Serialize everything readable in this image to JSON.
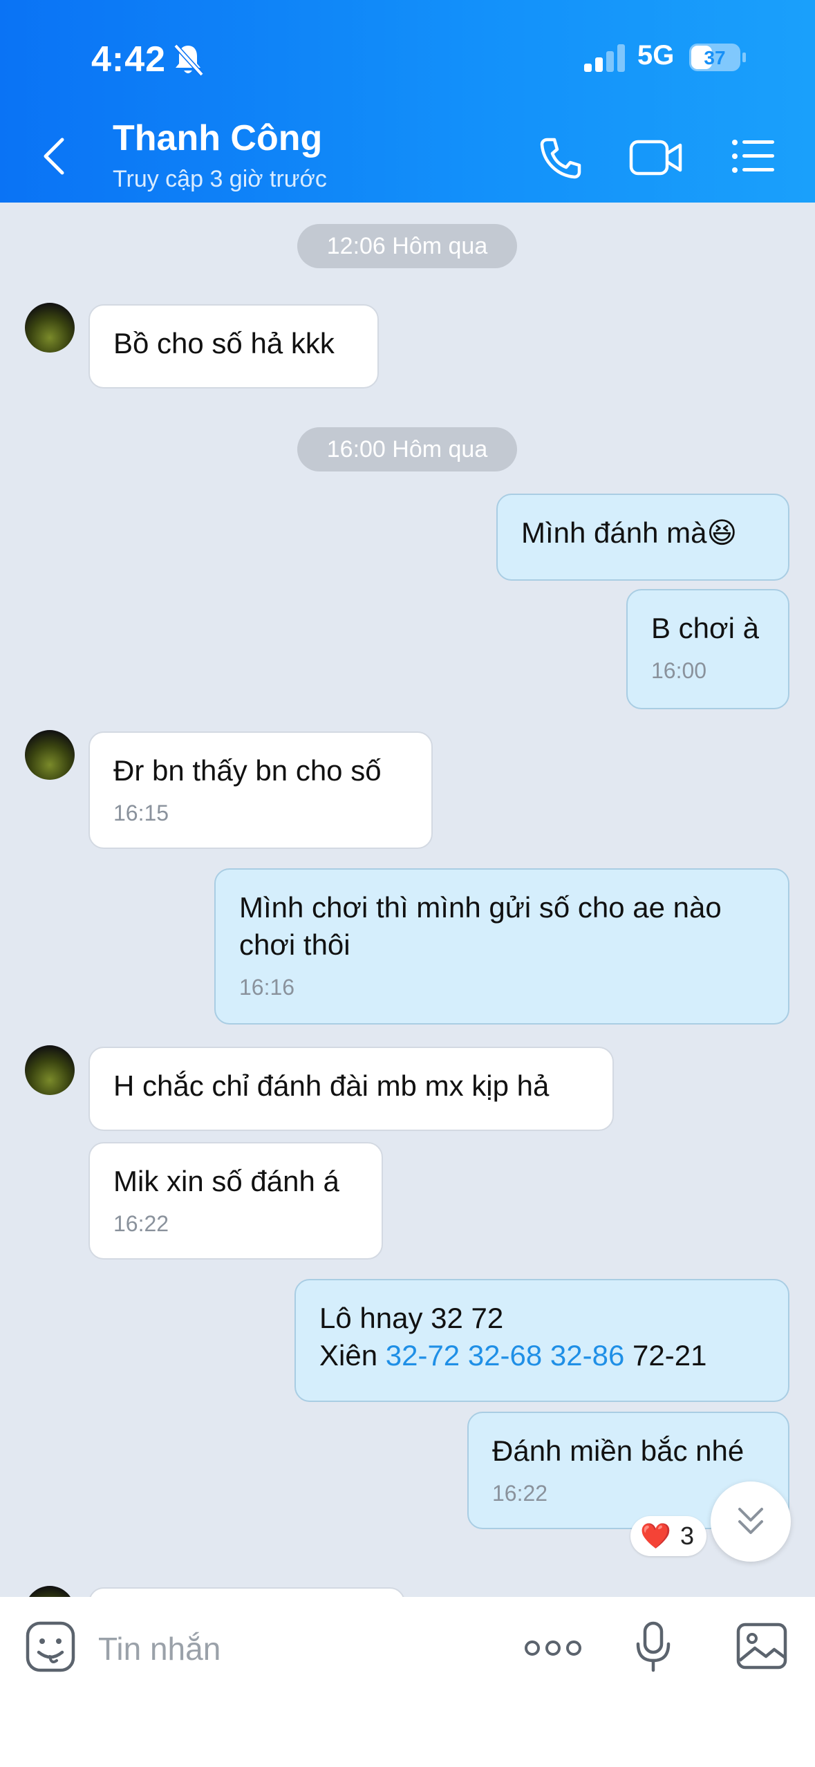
{
  "status_bar": {
    "time": "4:42",
    "network": "5G",
    "battery": "37"
  },
  "header": {
    "name": "Thanh Công",
    "last_seen": "Truy cập 3 giờ trước",
    "icons": [
      "back-arrow-icon",
      "phone-icon",
      "video-camera-icon",
      "menu-list-icon"
    ]
  },
  "date_separators": [
    "12:06 Hôm qua",
    "16:00 Hôm qua"
  ],
  "messages": [
    {
      "dir": "in",
      "text": "Bồ cho số hả kkk",
      "time": ""
    },
    {
      "dir": "out",
      "text": "Mình đánh mà😆",
      "time": ""
    },
    {
      "dir": "out",
      "text": "B chơi à",
      "time": "16:00"
    },
    {
      "dir": "in",
      "text": "Đr bn thấy bn cho số",
      "time": "16:15"
    },
    {
      "dir": "out",
      "line1": "Mình chơi thì mình gửi số cho ae nào",
      "line2": "chơi thôi",
      "time": "16:16"
    },
    {
      "dir": "in",
      "text": "H chắc chỉ đánh đài mb mx kịp hả",
      "time": ""
    },
    {
      "dir": "in",
      "text": "Mik xin số đánh á",
      "time": "16:22"
    },
    {
      "dir": "out",
      "line1": "Lô hnay 32 72",
      "line2_prefix": "Xiên",
      "links": [
        "32-72",
        "32-68",
        "32-86"
      ],
      "line2_suffix": "72-21",
      "time": ""
    },
    {
      "dir": "out",
      "text": "Đánh miền bắc nhé",
      "time": "16:22"
    }
  ],
  "reaction": {
    "emoji": "❤️",
    "count": "3"
  },
  "input": {
    "placeholder": "Tin nhắn"
  },
  "colors": {
    "header_start": "#0a73f5",
    "header_end": "#1aa0fb",
    "bubble_out": "#d5eefc",
    "bubble_in": "#ffffff",
    "link": "#1f8fe6"
  }
}
